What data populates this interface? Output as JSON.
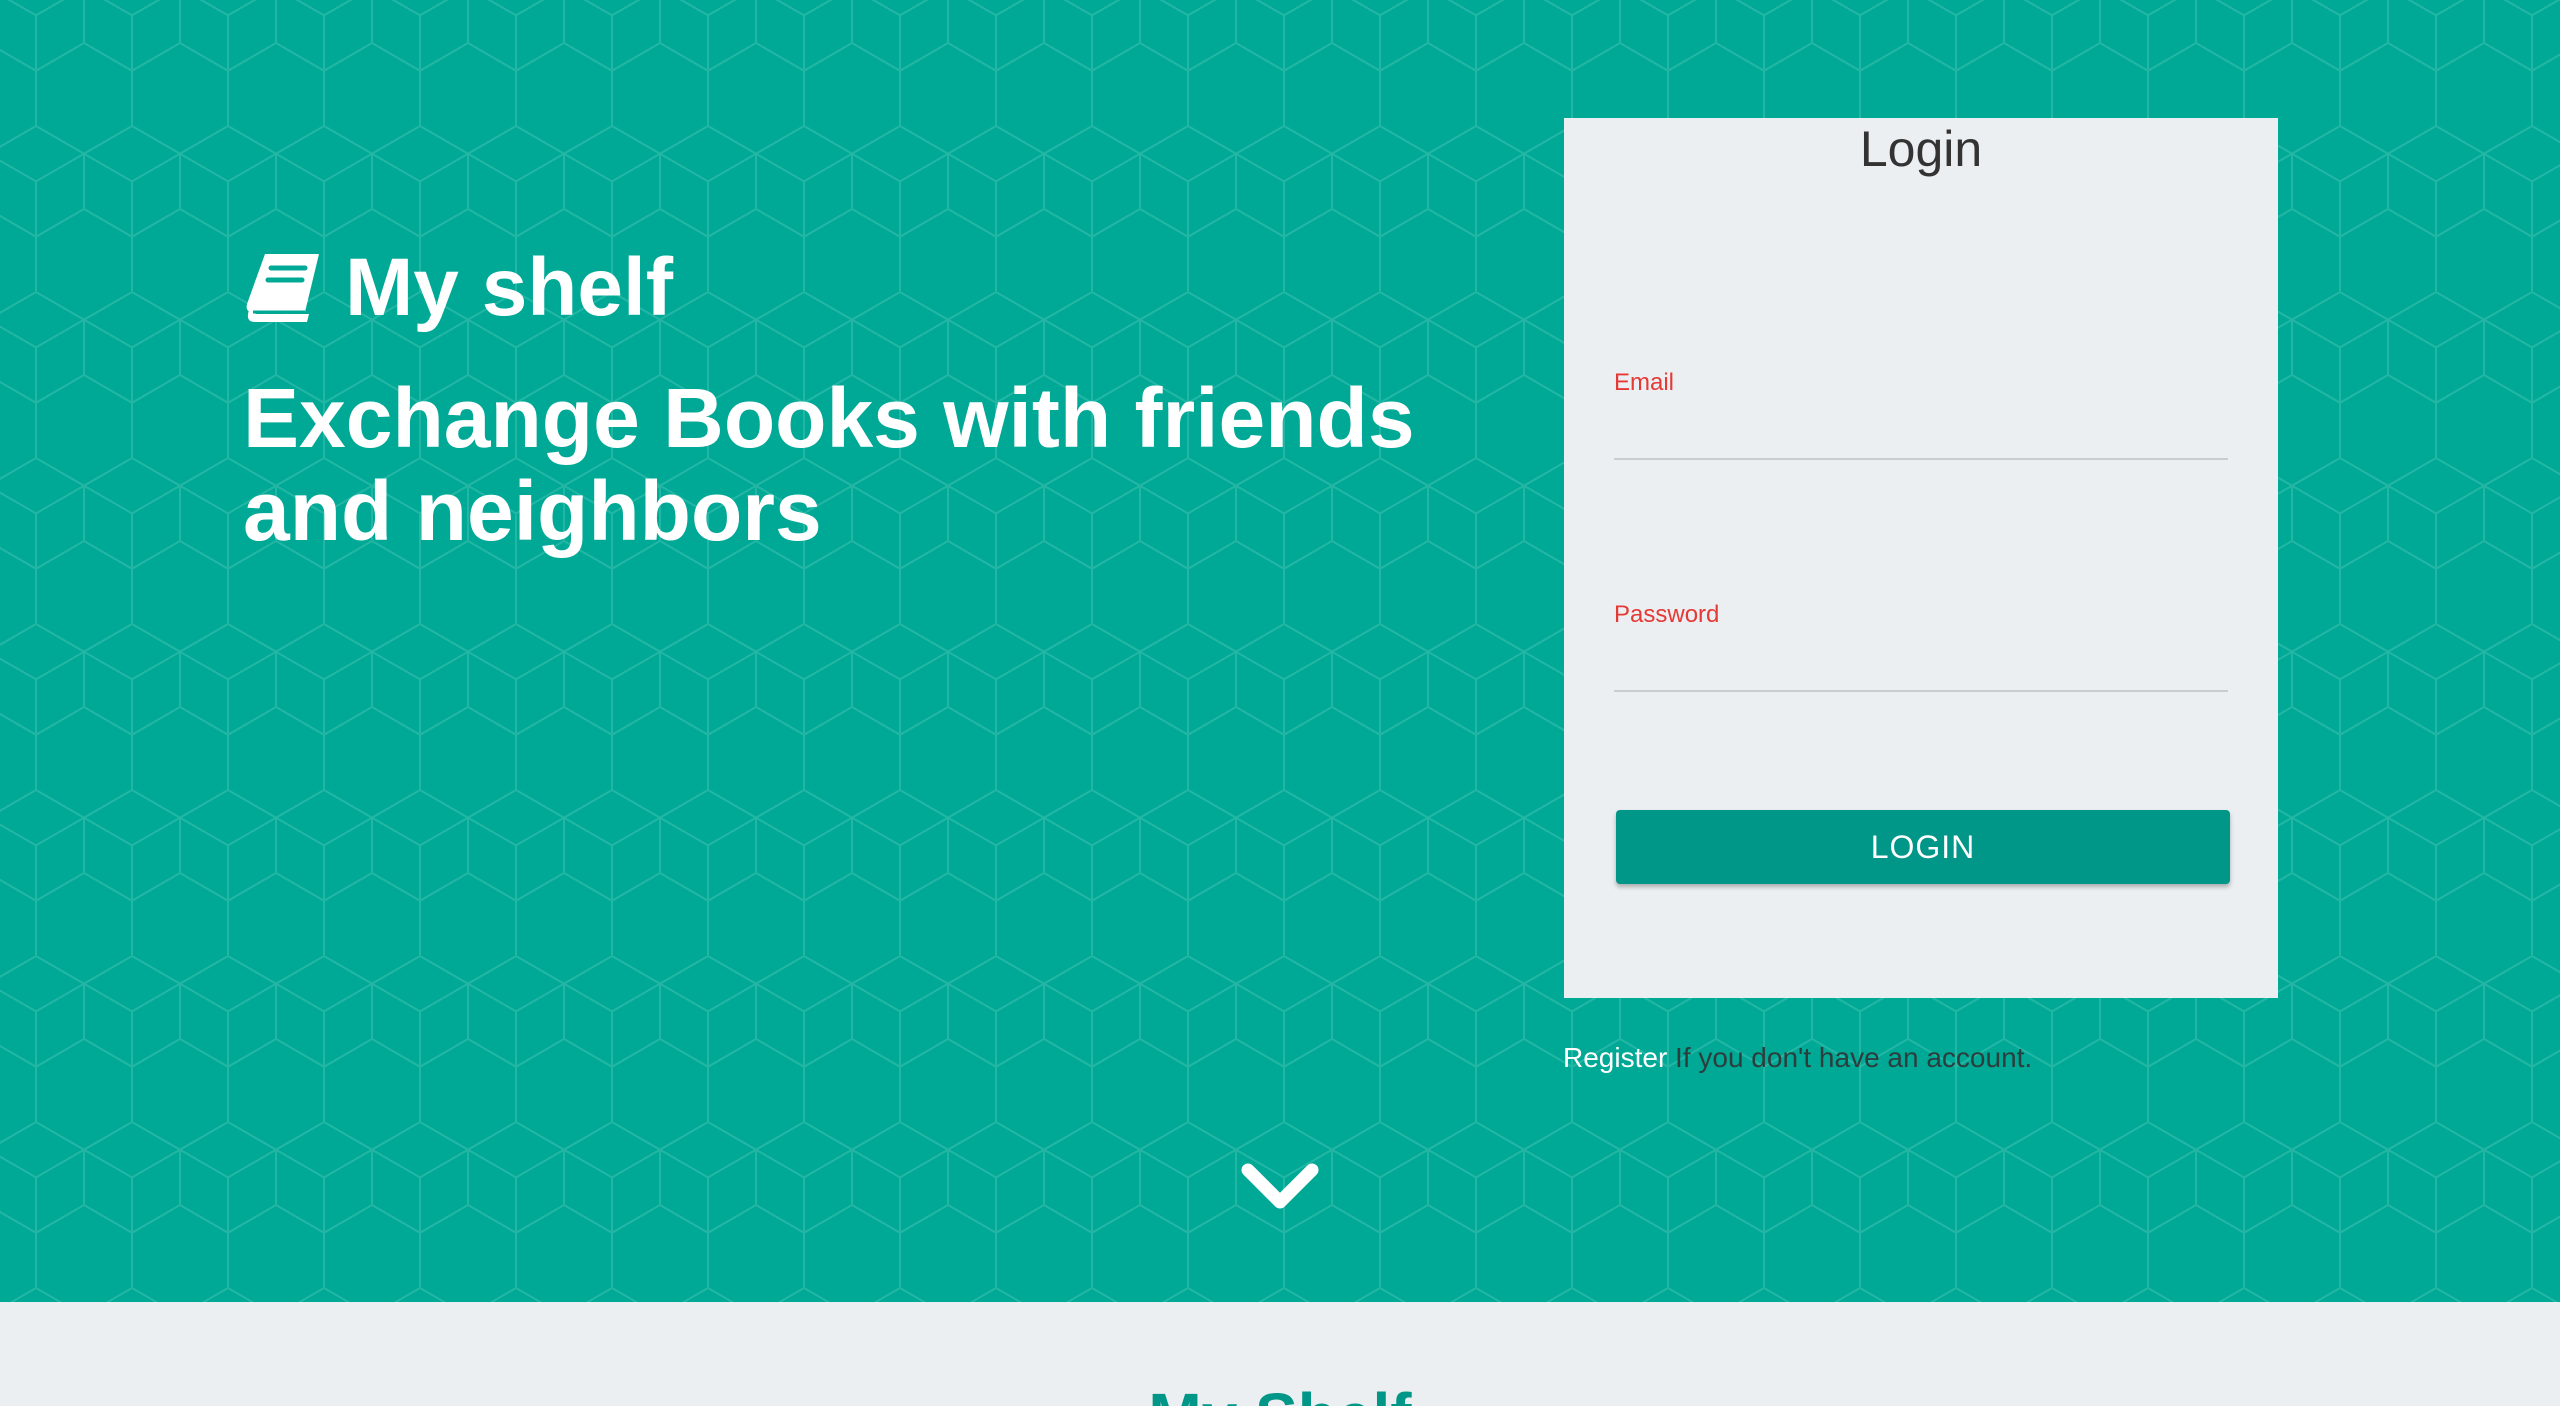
{
  "hero": {
    "brand_icon": "book-icon",
    "brand_name": "My shelf",
    "tagline": "Exchange Books with friends and neighbors",
    "scroll_icon": "chevron-down-icon",
    "background_color": "#00a896"
  },
  "login": {
    "title": "Login",
    "email_label": "Email",
    "email_value": "",
    "password_label": "Password",
    "password_value": "",
    "button_label": "LOGIN",
    "label_color": "#e53935",
    "button_color": "#009688"
  },
  "register": {
    "link_label": "Register",
    "text": " If you don't have an account."
  },
  "section": {
    "title": "My Shelf"
  }
}
